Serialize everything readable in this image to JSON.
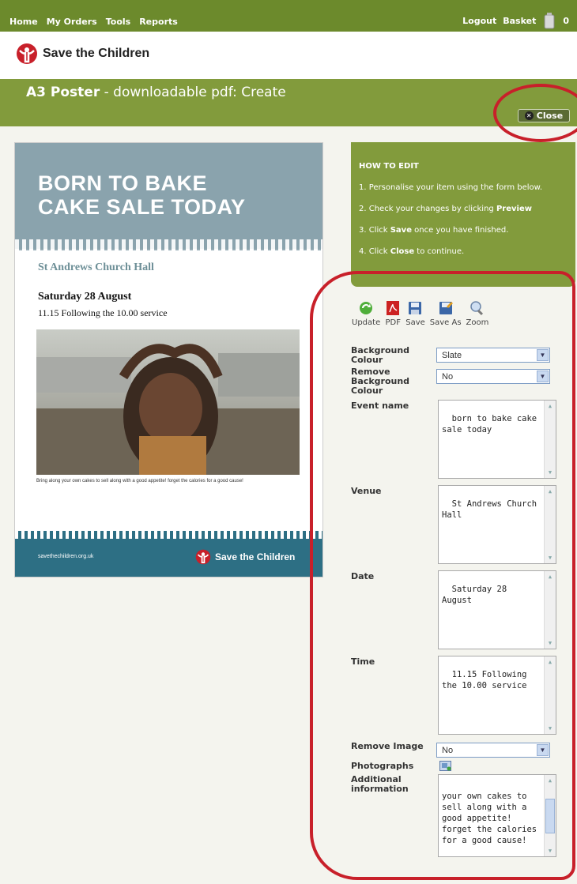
{
  "nav": {
    "links": [
      "Home",
      "My Orders",
      "Tools",
      "Reports"
    ],
    "logout": "Logout",
    "basket": "Basket",
    "basket_count": "0"
  },
  "brand": {
    "name": "Save the Children",
    "logo_color": "#c8202a"
  },
  "page": {
    "title_bold": "A3 Poster",
    "title_rest": "- downloadable pdf: Create",
    "close_label": "Close"
  },
  "poster": {
    "headline_line1": "BORN TO BAKE",
    "headline_line2": "CAKE SALE TODAY",
    "venue": "St Andrews Church Hall",
    "date": "Saturday 28 August",
    "time": "11.15 Following the 10.00 service",
    "caption": "Bring along your own cakes to sell along with a good appetite! forget the calories for a good cause!",
    "footer_url": "savethechildren.org.uk",
    "footer_brand": "Save the Children"
  },
  "howto": {
    "title": "HOW TO EDIT",
    "step1": "1. Personalise your item using the form below.",
    "step2_pre": "2. Check your changes by clicking ",
    "step2_bold": "Preview",
    "step3_pre": "3. Click ",
    "step3_bold": "Save",
    "step3_post": " once you have finished.",
    "step4_pre": "4. Click ",
    "step4_bold": "Close",
    "step4_post": " to continue."
  },
  "toolbar": {
    "update": "Update",
    "pdf": "PDF",
    "save": "Save",
    "save_as": "Save As",
    "zoom": "Zoom"
  },
  "form": {
    "background_colour_label": "Background Colour",
    "background_colour_value": "Slate",
    "remove_bg_label": "Remove Background Colour",
    "remove_bg_value": "No",
    "event_name_label": "Event name",
    "event_name_value": "born to bake cake sale today",
    "venue_label": "Venue",
    "venue_value": "St Andrews Church Hall",
    "date_label": "Date",
    "date_value": "Saturday 28 August",
    "time_label": "Time",
    "time_value": "11.15 Following the 10.00 service",
    "remove_image_label": "Remove Image",
    "remove_image_value": "No",
    "photographs_label": "Photographs",
    "additional_label": "Additional information",
    "additional_value": "your own cakes to sell along with a good appetite! forget the calories for a good cause!"
  },
  "colors": {
    "nav_green": "#6c8a2c",
    "band_green": "#829b3c",
    "slate": "#8aa3ad",
    "footer_teal": "#2d6f84",
    "highlight_red": "#c8202a"
  }
}
